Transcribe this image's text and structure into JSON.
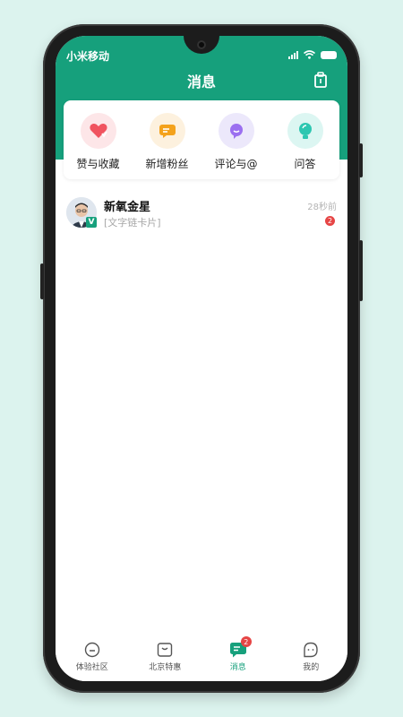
{
  "status_bar": {
    "carrier": "小米移动",
    "icons": [
      "signal-icon",
      "wifi-icon",
      "battery-icon"
    ]
  },
  "header": {
    "title": "消息",
    "action_icon": "clipboard-icon"
  },
  "quick_actions": [
    {
      "label": "赞与收藏",
      "icon": "heart-icon",
      "bg": "#fde6e8",
      "color": "#f0535f"
    },
    {
      "label": "新增粉丝",
      "icon": "chat-icon",
      "bg": "#fdf1de",
      "color": "#f4a21b"
    },
    {
      "label": "评论与@",
      "icon": "comment-icon",
      "bg": "#ece8fb",
      "color": "#9b6ff0"
    },
    {
      "label": "问答",
      "icon": "bulb-icon",
      "bg": "#dcf6f2",
      "color": "#2ec7b1"
    }
  ],
  "messages": [
    {
      "name": "新氧金星",
      "preview": "[文字链卡片]",
      "time": "28秒前",
      "unread": "2",
      "verified": "V"
    }
  ],
  "tab_bar": {
    "items": [
      {
        "label": "体验社区",
        "icon": "community-icon"
      },
      {
        "label": "北京特惠",
        "icon": "deals-icon"
      },
      {
        "label": "消息",
        "icon": "message-icon",
        "badge": "2",
        "active": true
      },
      {
        "label": "我的",
        "icon": "profile-icon"
      }
    ]
  },
  "colors": {
    "brand": "#16a07c",
    "badge": "#e64545",
    "page_bg": "#dcf3ee"
  }
}
